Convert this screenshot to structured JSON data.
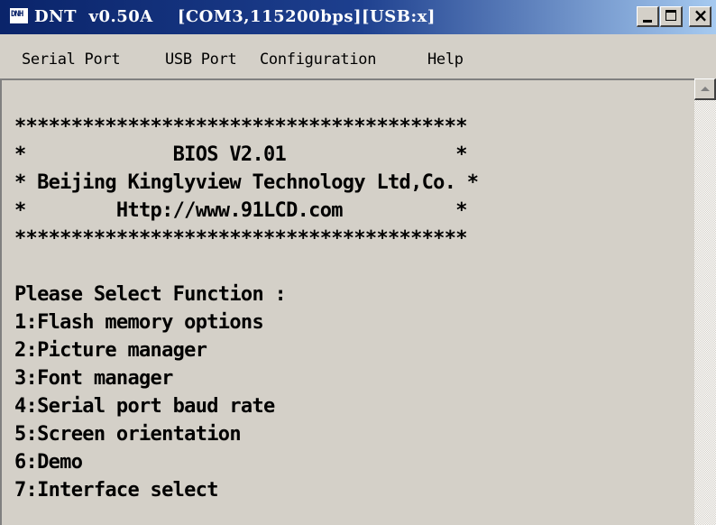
{
  "window": {
    "app_icon_text": "DNH",
    "title": "DNT  v0.50A    [COM3,115200bps][USB:x]"
  },
  "menu": [
    "Serial Port",
    "USB Port",
    "Configuration",
    "Help"
  ],
  "terminal": {
    "lines": [
      "****************************************",
      "*             BIOS V2.01               *",
      "* Beijing Kinglyview Technology Ltd,Co. *",
      "*        Http://www.91LCD.com          *",
      "****************************************",
      "",
      "Please Select Function :",
      "1:Flash memory options",
      "2:Picture manager",
      "3:Font manager",
      "4:Serial port baud rate",
      "5:Screen orientation",
      "6:Demo",
      "7:Interface select"
    ]
  },
  "colors": {
    "titlebar_start": "#0a246a",
    "titlebar_end": "#a6caf0",
    "face": "#d4d0c8"
  },
  "icons": [
    "app-icon",
    "minimize-icon",
    "maximize-icon",
    "close-icon",
    "scroll-up-arrow-icon"
  ]
}
